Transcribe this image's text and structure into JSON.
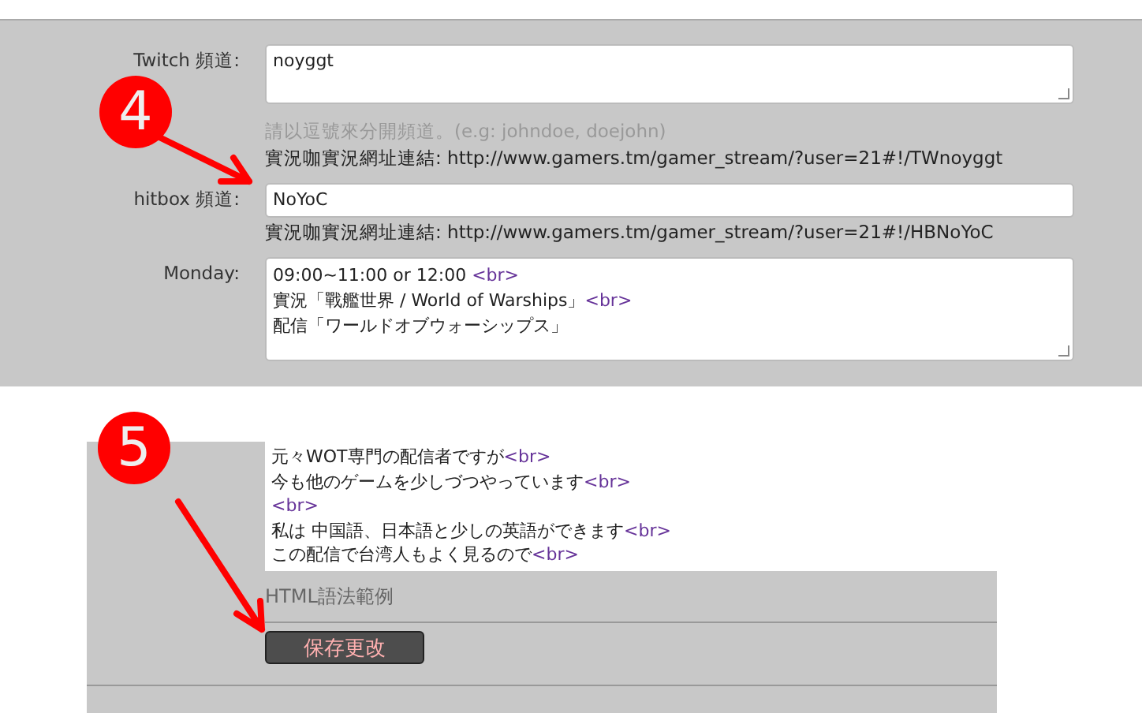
{
  "channels": [
    {
      "label": "Twitch 頻道:",
      "kind": "textarea",
      "value": "noyggt",
      "hint": "請以逗號來分開頻道。(e.g: johndoe, doejohn)",
      "link": "實況咖實況網址連結: http://www.gamers.tm/gamer_stream/?user=21#!/TWnoyggt"
    },
    {
      "label": "hitbox 頻道:",
      "kind": "input",
      "value": "NoYoC",
      "link": "實況咖實況網址連結: http://www.gamers.tm/gamer_stream/?user=21#!/HBNoYoC"
    }
  ],
  "schedule": {
    "label": "Monday:",
    "lines": [
      {
        "text": "09:00~11:00 or 12:00  ",
        "tag": "<br>"
      },
      {
        "text": "實況「戰艦世界 / World of Warships」",
        "tag": "<br>"
      },
      {
        "text": "配信「ワールドオブウォーシップス」"
      }
    ]
  },
  "intro": {
    "lines": [
      {
        "text": "元々WOT専門の配信者ですが",
        "tag": "<br>"
      },
      {
        "text": "今も他のゲームを少しづつやっています",
        "tag": "<br>"
      },
      {
        "tag": "<br>"
      },
      {
        "text": "私は 中国語、日本語と少しの英語ができます",
        "tag": "<br>"
      },
      {
        "text": "この配信で台湾人もよく見るので",
        "tag": "<br>"
      }
    ],
    "hint": "HTML語法範例"
  },
  "save_button": "保存更改",
  "steps": [
    {
      "number": "4"
    },
    {
      "number": "5"
    }
  ]
}
